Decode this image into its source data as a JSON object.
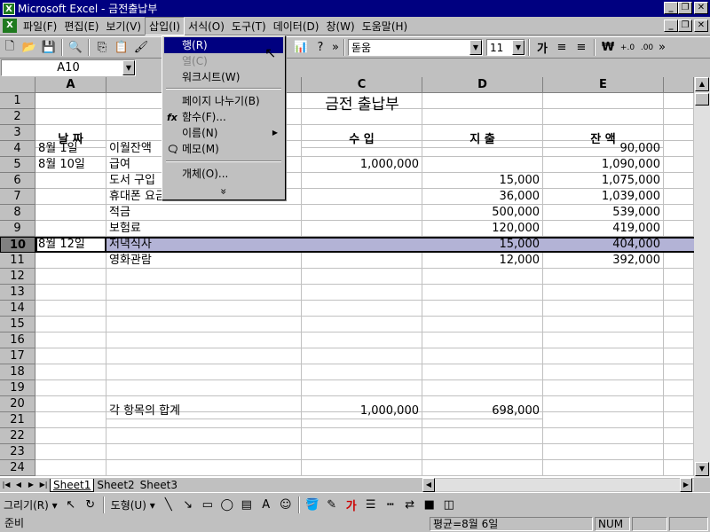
{
  "titlebar": {
    "title": "Microsoft Excel - 금전출납부",
    "app_icon": "excel-icon"
  },
  "menubar": {
    "items": [
      "파일(F)",
      "편집(E)",
      "보기(V)",
      "삽입(I)",
      "서식(O)",
      "도구(T)",
      "데이터(D)",
      "창(W)",
      "도움말(H)"
    ]
  },
  "toolbar": {
    "font_name": "돋움",
    "font_size": "11",
    "bold_label": "가"
  },
  "formulabar": {
    "name_box": "A10"
  },
  "sheet": {
    "columns": [
      "A",
      "B",
      "C",
      "D",
      "E"
    ],
    "rows": [
      "1",
      "2",
      "3",
      "4",
      "5",
      "6",
      "7",
      "8",
      "9",
      "10",
      "11",
      "12",
      "13",
      "14",
      "15",
      "16",
      "17",
      "18",
      "19",
      "20",
      "21",
      "22",
      "23",
      "24"
    ],
    "title": "금전 출납부",
    "headers": {
      "date": "날  짜",
      "income": "수     입",
      "expense": "지     출",
      "balance": "잔     액"
    },
    "data": [
      {
        "date": "8월  1일",
        "item": "이월잔액",
        "income": "",
        "expense": "",
        "balance": "90,000"
      },
      {
        "date": "8월 10일",
        "item": "급여",
        "income": "1,000,000",
        "expense": "",
        "balance": "1,090,000"
      },
      {
        "date": "",
        "item": "도서 구입",
        "income": "",
        "expense": "15,000",
        "balance": "1,075,000"
      },
      {
        "date": "",
        "item": "휴대폰 요금(7월분)",
        "income": "",
        "expense": "36,000",
        "balance": "1,039,000"
      },
      {
        "date": "",
        "item": "적금",
        "income": "",
        "expense": "500,000",
        "balance": "539,000"
      },
      {
        "date": "",
        "item": "보험료",
        "income": "",
        "expense": "120,000",
        "balance": "419,000"
      },
      {
        "date": "8월 12일",
        "item": "저녁식사",
        "income": "",
        "expense": "15,000",
        "balance": "404,000"
      },
      {
        "date": "",
        "item": "영화관람",
        "income": "",
        "expense": "12,000",
        "balance": "392,000"
      }
    ],
    "total": {
      "label": "각 항목의 합계",
      "income": "1,000,000",
      "expense": "698,000"
    },
    "tabs": [
      "Sheet1",
      "Sheet2",
      "Sheet3"
    ]
  },
  "insert_menu": {
    "items": [
      "행(R)",
      "열(C)",
      "워크시트(W)",
      "페이지 나누기(B)",
      "함수(F)...",
      "이름(N)",
      "메모(M)",
      "개체(O)..."
    ],
    "function_icon": "fx",
    "more": "»"
  },
  "drawbar": {
    "draw_label": "그리기(R)",
    "autoshape_label": "도형(U)",
    "font_color_label": "가"
  },
  "statusbar": {
    "status": "준비",
    "summary": "평균=8월 6일",
    "num": "NUM"
  }
}
